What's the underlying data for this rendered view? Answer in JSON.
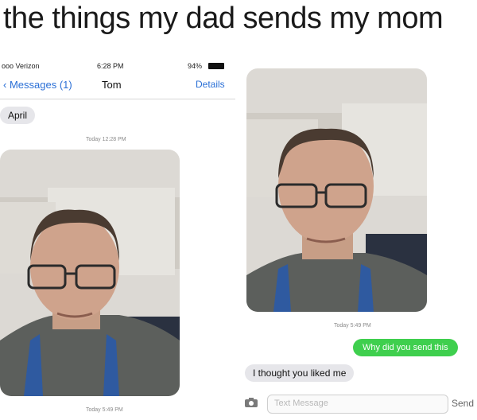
{
  "caption": "the things my dad sends my mom",
  "status": {
    "carrier": "ooo Verizon",
    "time": "6:28 PM",
    "battery": "94%"
  },
  "nav": {
    "back_label": "Messages (1)",
    "title": "Tom",
    "details_label": "Details"
  },
  "messages": {
    "april_label": "April",
    "stamp1": "Today 12:28 PM",
    "stamp2": "Today 5:49 PM",
    "stamp3": "Today 5:49 PM",
    "sent_text": "Why did you send this",
    "reply_text": "I thought you liked me"
  },
  "composer": {
    "placeholder": "Text Message",
    "send_label": "Send"
  }
}
